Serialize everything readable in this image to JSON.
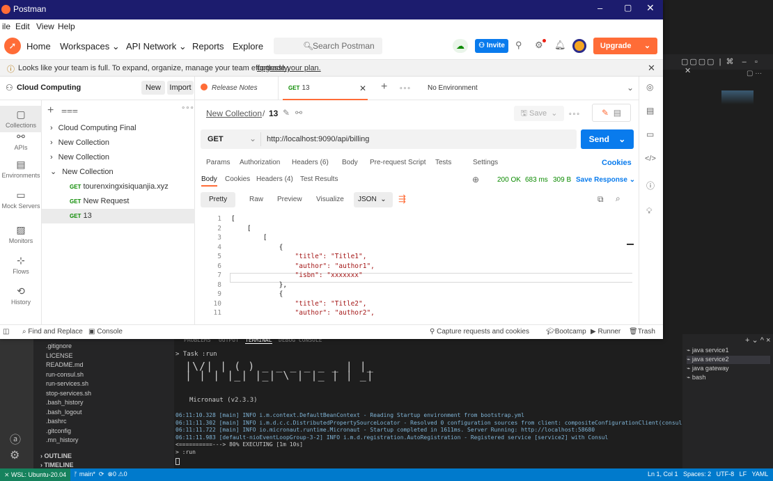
{
  "postman": {
    "title": "Postman",
    "menu": [
      "ile",
      "Edit",
      "View",
      "Help"
    ],
    "header": {
      "home": "Home",
      "workspaces": "Workspaces",
      "api_network": "API Network",
      "reports": "Reports",
      "explore": "Explore",
      "search_placeholder": "Search Postman",
      "invite": "Invite",
      "upgrade": "Upgrade"
    },
    "banner": {
      "text": "Looks like your team is full. To expand, organize, manage your team effortlessly,",
      "link": "upgrade your plan."
    },
    "workspace": {
      "name": "Cloud Computing",
      "new": "New",
      "import": "Import"
    },
    "nav": [
      {
        "label": "Collections",
        "icon": "collections-icon"
      },
      {
        "label": "APIs",
        "icon": "apis-icon"
      },
      {
        "label": "Environments",
        "icon": "environments-icon"
      },
      {
        "label": "Mock Servers",
        "icon": "mock-servers-icon"
      },
      {
        "label": "Monitors",
        "icon": "monitors-icon"
      },
      {
        "label": "Flows",
        "icon": "flows-icon"
      },
      {
        "label": "History",
        "icon": "history-icon"
      }
    ],
    "tree": {
      "c1": "Cloud Computing Final",
      "c2": "New Collection",
      "c3": "New Collection",
      "c4": "New Collection",
      "r1_method": "GET",
      "r1": "tourenxingxisiquanjia.xyz",
      "r2_method": "GET",
      "r2": "New Request",
      "r3_method": "GET",
      "r3": "13"
    },
    "tabs": {
      "release_notes": "Release Notes",
      "active_method": "GET",
      "active": "13",
      "environment": "No Environment"
    },
    "request": {
      "breadcrumb_collection": "New Collection",
      "breadcrumb_sep": "/",
      "name": "13",
      "save": "Save",
      "method": "GET",
      "url": "http://localhost:9090/api/billing",
      "send": "Send",
      "tabs": [
        "Params",
        "Authorization",
        "Headers (6)",
        "Body",
        "Pre-request Script",
        "Tests",
        "Settings"
      ],
      "cookies": "Cookies"
    },
    "response": {
      "tabs": [
        "Body",
        "Cookies",
        "Headers (4)",
        "Test Results"
      ],
      "status": "200 OK",
      "time": "683 ms",
      "size": "309 B",
      "save_response": "Save Response",
      "views": [
        "Pretty",
        "Raw",
        "Preview",
        "Visualize"
      ],
      "format": "JSON",
      "lines": [
        {
          "n": "1",
          "t": "["
        },
        {
          "n": "2",
          "t": "    ["
        },
        {
          "n": "3",
          "t": "        ["
        },
        {
          "n": "4",
          "t": "            {"
        },
        {
          "n": "5",
          "t": "                \"title\": \"Title1\","
        },
        {
          "n": "6",
          "t": "                \"author\": \"author1\","
        },
        {
          "n": "7",
          "t": "                \"isbn\": \"xxxxxxx\""
        },
        {
          "n": "8",
          "t": "            },"
        },
        {
          "n": "9",
          "t": "            {"
        },
        {
          "n": "10",
          "t": "                \"title\": \"Title2\","
        },
        {
          "n": "11",
          "t": "                \"author\": \"author2\","
        }
      ]
    },
    "footer": {
      "find_replace": "Find and Replace",
      "console": "Console",
      "capture": "Capture requests and cookies",
      "bootcamp": "Bootcamp",
      "runner": "Runner",
      "trash": "Trash"
    }
  },
  "vscode": {
    "explorer": [
      ".gitignore",
      "LICENSE",
      "README.md",
      "run-consul.sh",
      "run-services.sh",
      "stop-services.sh",
      ".bash_history",
      ".bash_logout",
      ".bashrc",
      ".gitconfig",
      ".mn_history"
    ],
    "outline": "OUTLINE",
    "timeline": "TIMELINE",
    "terminal_tabs": [
      "PROBLEMS",
      "OUTPUT",
      "TERMINAL",
      "DEBUG CONSOLE"
    ],
    "terminal": {
      "task": "> Task :run",
      "version": "Micronaut (v2.3.3)",
      "log": [
        "06:11:10.328 [main] INFO  i.m.context.DefaultBeanContext - Reading Startup environment from bootstrap.yml",
        "06:11:11.302 [main] INFO  i.m.d.c.c.DistributedPropertySourceLocator - Resolved 0 configuration sources from client: compositeConfigurationClient(consul)",
        "06:11:11.722 [main] INFO  io.micronaut.runtime.Micronaut - Startup completed in 1611ms. Server Running: http://localhost:58680",
        "06:11:11.983 [default-nioEventLoopGroup-3-2] INFO  i.m.d.registration.AutoRegistration - Registered service [service2] with Consul",
        "<==========---> 80% EXECUTING [1m 10s]",
        "> :run"
      ]
    },
    "terminals": [
      "java service1",
      "java service2",
      "java gateway",
      "bash"
    ],
    "status": {
      "remote": "WSL: Ubuntu-20.04",
      "branch": "main*",
      "problems": "0",
      "warnings": "0",
      "position": "Ln 1, Col 1",
      "spaces": "Spaces: 2",
      "encoding": "UTF-8",
      "eol": "LF",
      "language": "YAML"
    }
  }
}
